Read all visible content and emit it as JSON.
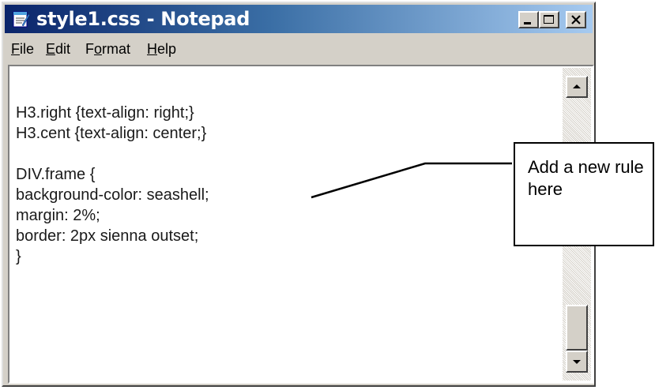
{
  "window": {
    "title": "style1.css - Notepad"
  },
  "menu": {
    "items": [
      {
        "label_u": "F",
        "label_rest": "ile"
      },
      {
        "label_u": "E",
        "label_rest": "dit"
      },
      {
        "label_pre": "F",
        "label_u": "o",
        "label_rest": "rmat"
      },
      {
        "label_u": "H",
        "label_rest": "elp"
      }
    ]
  },
  "editor": {
    "lines": [
      "H3.right {text-align: right;}",
      "H3.cent {text-align: center;}",
      "",
      "DIV.frame {",
      "background-color: seashell;",
      "margin: 2%;",
      "border: 2px sienna outset;",
      "}"
    ]
  },
  "callout": {
    "text": "Add a new rule here"
  },
  "icons": {
    "app": "notepad-icon",
    "minimize": "minimize-icon",
    "maximize": "maximize-icon",
    "close": "close-icon",
    "scroll_up": "arrow-up-icon",
    "scroll_down": "arrow-down-icon"
  },
  "colors": {
    "titlebar_start": "#0a246a",
    "titlebar_end": "#a6caf0",
    "chrome": "#d4d0c8"
  }
}
